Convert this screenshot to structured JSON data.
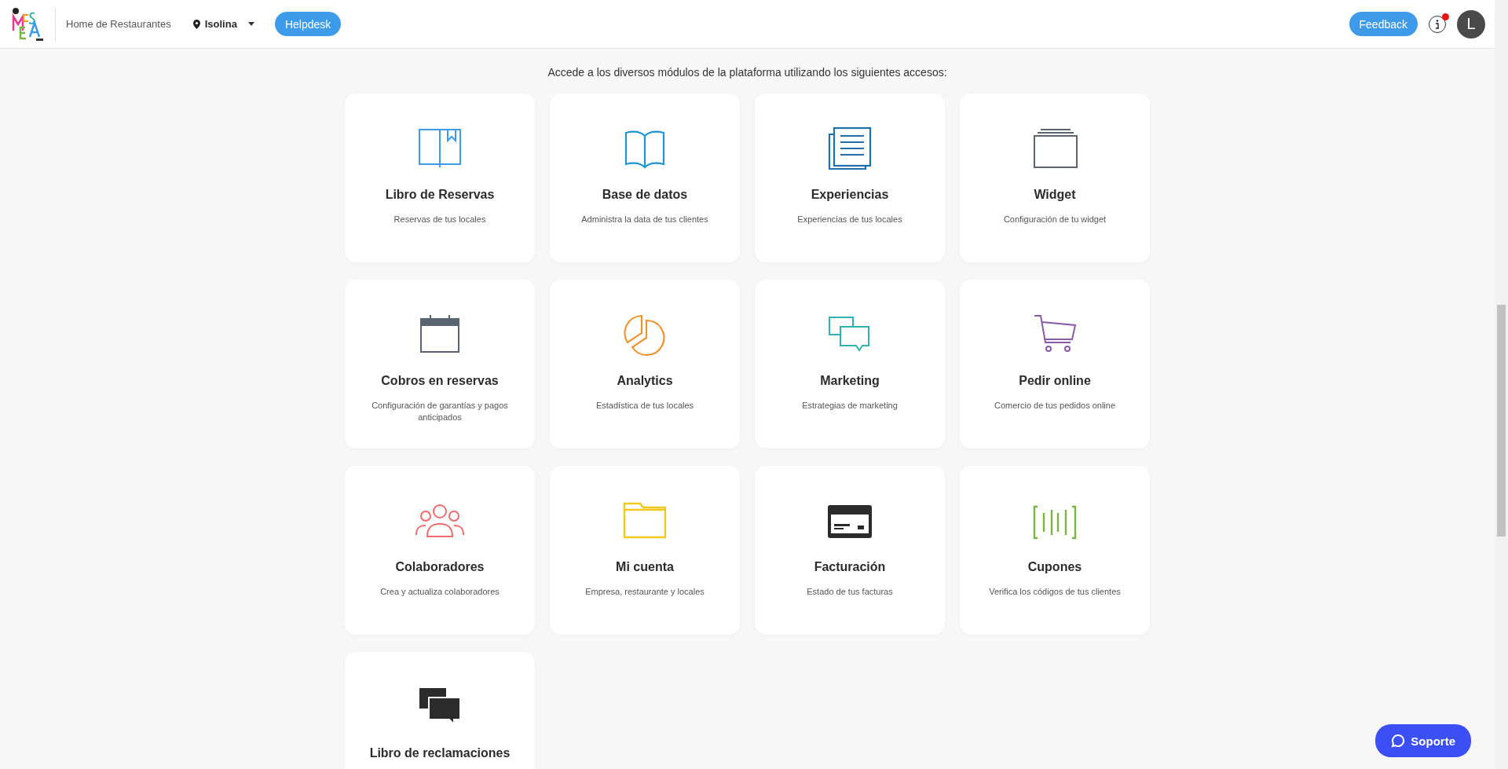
{
  "header": {
    "breadcrumb": "Home de Restaurantes",
    "location": "Isolina",
    "helpdesk": "Helpdesk",
    "feedback": "Feedback",
    "info_notification": true,
    "avatar": "L"
  },
  "intro": "Accede a los diversos módulos de la plataforma utilizando los siguientes accesos:",
  "modules": [
    {
      "title": "Libro de Reservas",
      "description": "Reservas de tus locales",
      "color": "#3d9be9"
    },
    {
      "title": "Base de datos",
      "description": "Administra la data de tus clientes",
      "color": "#1f95d3"
    },
    {
      "title": "Experiencias",
      "description": "Experiencias de tus locales",
      "color": "#1f6fae"
    },
    {
      "title": "Widget",
      "description": "Configuración de tu widget",
      "color": "#5a6572"
    },
    {
      "title": "Cobros en reservas",
      "description": "Configuración de garantías y pagos anticipados",
      "color": "#5a6572"
    },
    {
      "title": "Analytics",
      "description": "Estadística de tus locales",
      "color": "#ef9330"
    },
    {
      "title": "Marketing",
      "description": "Estrategias de marketing",
      "color": "#2fb3b0"
    },
    {
      "title": "Pedir online",
      "description": "Comercio de tus pedidos online",
      "color": "#8a5aa8"
    },
    {
      "title": "Colaboradores",
      "description": "Crea y actualiza colaboradores",
      "color": "#ef6b6b"
    },
    {
      "title": "Mi cuenta",
      "description": "Empresa, restaurante y locales",
      "color": "#f2c81e"
    },
    {
      "title": "Facturación",
      "description": "Estado de tus facturas",
      "color": "#2b2b2b"
    },
    {
      "title": "Cupones",
      "description": "Verifica los códigos de tus clientes",
      "color": "#7cb342"
    },
    {
      "title": "Libro de reclamaciones",
      "color": "#2b2b2b"
    }
  ],
  "support": "Soporte"
}
